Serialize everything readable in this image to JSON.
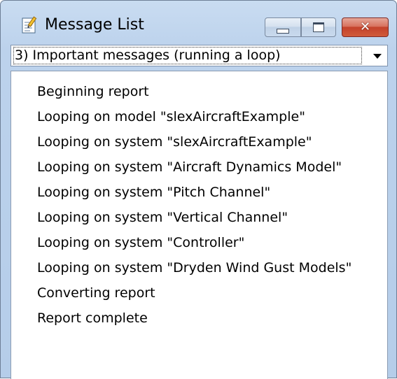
{
  "window": {
    "title": "Message List",
    "icon": "message-list-app-icon"
  },
  "controls": {
    "minimize": "minimize-icon",
    "maximize": "maximize-icon",
    "close": "close-icon",
    "close_glyph": "✕"
  },
  "filter": {
    "selected": "3) Important messages (running a loop)"
  },
  "messages": [
    "Beginning report",
    "Looping on model \"slexAircraftExample\"",
    "Looping on system \"slexAircraftExample\"",
    "Looping on system \"Aircraft Dynamics Model\"",
    "Looping on system \"Pitch Channel\"",
    "Looping on system \"Vertical Channel\"",
    "Looping on system \"Controller\"",
    "Looping on system \"Dryden Wind Gust Models\"",
    "Converting report",
    "Report complete"
  ],
  "colors": {
    "title_bar": "#bcd2ec",
    "close_button": "#c4422b"
  }
}
